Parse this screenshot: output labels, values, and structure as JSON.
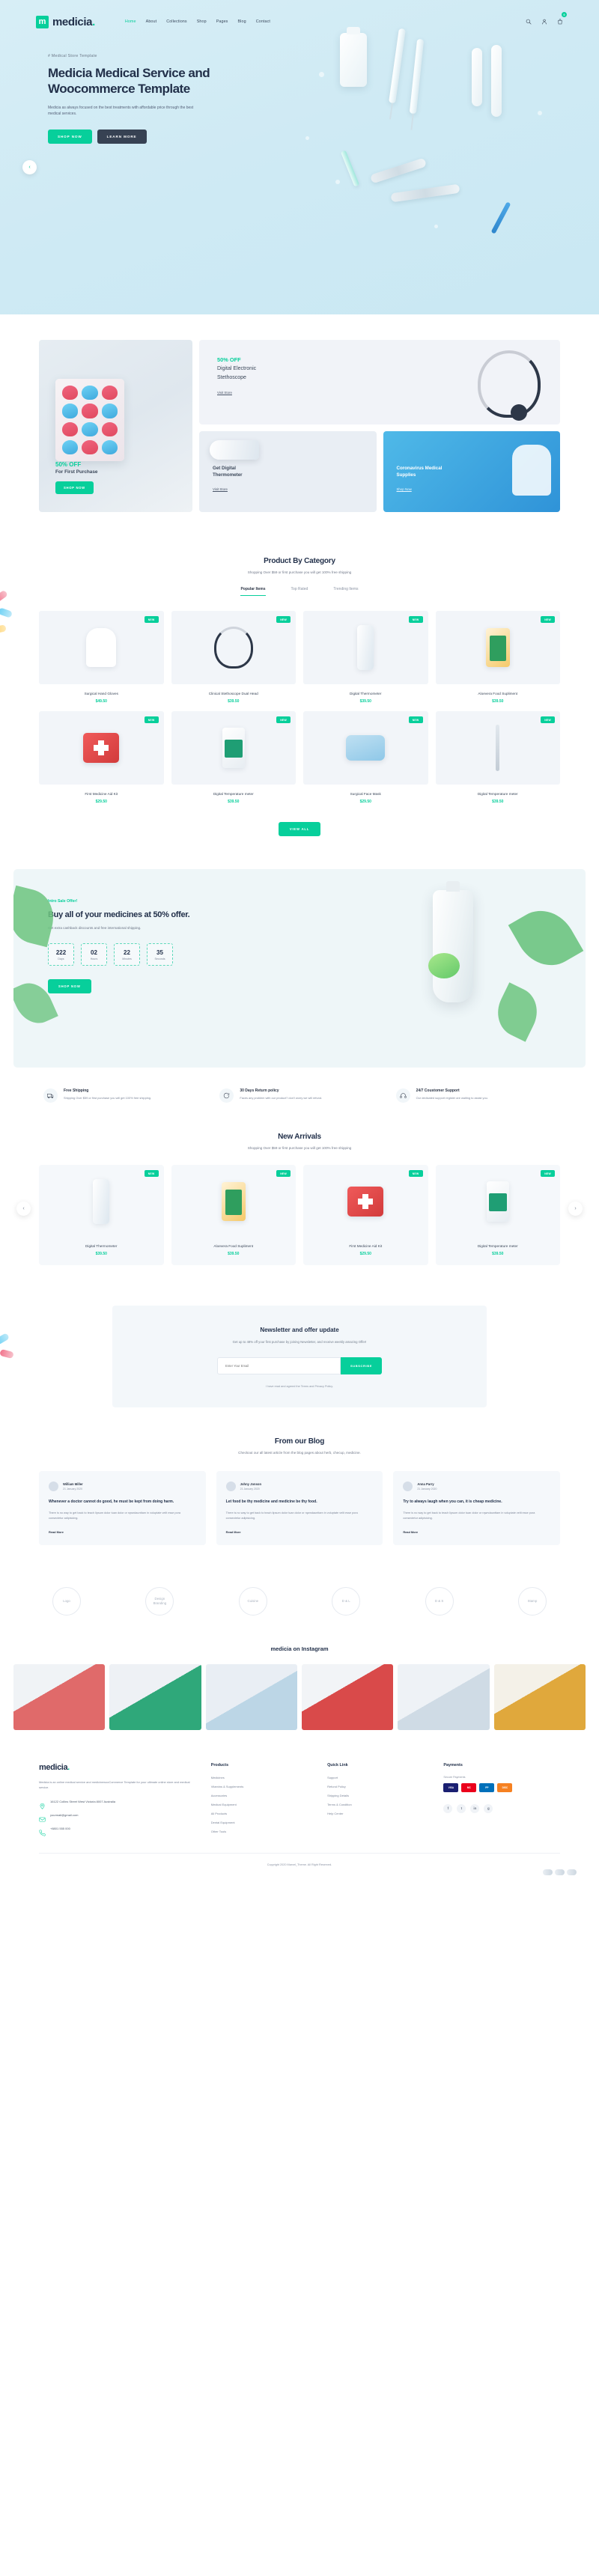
{
  "brand": {
    "name": "medicia",
    "mark": "m",
    "dot": "."
  },
  "colors": {
    "accent": "#07cf9b",
    "dark": "#22304a",
    "muted": "#7d8699"
  },
  "nav": {
    "links": [
      {
        "label": "Home",
        "active": true
      },
      {
        "label": "About",
        "active": false
      },
      {
        "label": "Collections",
        "active": false
      },
      {
        "label": "Shop",
        "active": false
      },
      {
        "label": "Pages",
        "active": false
      },
      {
        "label": "Blog",
        "active": false
      },
      {
        "label": "Contact",
        "active": false
      }
    ],
    "icons": [
      "search-icon",
      "user-icon",
      "cart-icon"
    ],
    "cart_count": "0"
  },
  "hero": {
    "kicker": "# Medical Store Template",
    "title_line1": "Medicia Medical Service and",
    "title_line2": "Woocommerce Template",
    "subtitle": "Medicia as always focused on the best treatments with affordable price through the best medical services.",
    "btn_primary": "SHOP NOW",
    "btn_secondary": "LEARN MORE",
    "arrow_left": "‹"
  },
  "promo": {
    "left": {
      "off": "50% OFF",
      "sub": "For First Purchase",
      "btn": "SHOP NOW"
    },
    "top": {
      "off": "50% OFF",
      "line1": "Digital Electronic",
      "line2": "Stethoscope",
      "link": "Visit Store"
    },
    "cards": [
      {
        "title": "Get Digital\nThermometer",
        "link": "Visit Store"
      },
      {
        "title": "Coronavirus Medical\nSupplies",
        "link": "Shop Now"
      }
    ]
  },
  "category": {
    "title": "Product By Category",
    "subtitle": "Shopping Over $59 or first purchase you will get 100% free shipping",
    "tabs": [
      {
        "label": "Popular Items",
        "active": true
      },
      {
        "label": "Top Rated",
        "active": false
      },
      {
        "label": "Trending Items",
        "active": false
      }
    ],
    "view_all": "VIEW ALL",
    "products": [
      {
        "name": "Surgical Hand Gloves",
        "price": "$49.50",
        "badge": "NEW",
        "art": "gloves"
      },
      {
        "name": "Clinical Stethoscope Dual Head",
        "price": "$39.50",
        "badge": "NEW",
        "art": "stetho"
      },
      {
        "name": "Digital Thermometer",
        "price": "$39.50",
        "badge": "NEW",
        "art": "therm"
      },
      {
        "name": "Aloevera Food Supliment",
        "price": "$39.50",
        "badge": "NEW",
        "art": "bottle"
      },
      {
        "name": "First Medicine Aid Kit",
        "price": "$29.50",
        "badge": "NEW",
        "art": "kit"
      },
      {
        "name": "Digital Temperature meter",
        "price": "$39.50",
        "badge": "NEW",
        "art": "suppl"
      },
      {
        "name": "Surgical Face Mask",
        "price": "$29.50",
        "badge": "NEW",
        "art": "mask"
      },
      {
        "name": "Digital Temperature meter",
        "price": "$39.50",
        "badge": "NEW",
        "art": "stick"
      }
    ]
  },
  "sale": {
    "kicker": "Intro Sale Offer!",
    "title": "Buy all of your medicines at 50% offer.",
    "subtitle": "Get extra cashback discounts and free international shipping.",
    "countdown": [
      {
        "value": "222",
        "label": "Days"
      },
      {
        "value": "02",
        "label": "Hours"
      },
      {
        "value": "22",
        "label": "Minutes"
      },
      {
        "value": "35",
        "label": "Seconds"
      }
    ],
    "btn": "SHOP NOW"
  },
  "features": [
    {
      "icon": "truck-icon",
      "title": "Free Shipping",
      "text": "Shipping Over $59 or first purchase you will get 100% free shipping."
    },
    {
      "icon": "refresh-icon",
      "title": "30 Days Return policy",
      "text": "Faces any problem with our product? don't worry we will refund."
    },
    {
      "icon": "headset-icon",
      "title": "24/7 Coustomer Support",
      "text": "Our dedicated support register are waiting to assist you."
    }
  ],
  "arrivals": {
    "title": "New Arrivals",
    "subtitle": "Shopping Over $59 or first purchase you will get 100% free shipping",
    "arrow_left": "‹",
    "arrow_right": "›",
    "products": [
      {
        "name": "Digital Thermometer",
        "price": "$39.50",
        "badge": "NEW",
        "art": "therm"
      },
      {
        "name": "Aloevera Food Supliment",
        "price": "$39.50",
        "badge": "NEW",
        "art": "bottle"
      },
      {
        "name": "First Medicine Aid Kit",
        "price": "$29.50",
        "badge": "NEW",
        "art": "kit"
      },
      {
        "name": "Digital Temperature meter",
        "price": "$39.50",
        "badge": "NEW",
        "art": "suppl"
      }
    ]
  },
  "newsletter": {
    "title": "Newsletter and offer update",
    "subtitle": "Get up to 48% off your first purchase by joining Newsletter, and receive weekly amazing Offer!",
    "placeholder": "Enter Your Email",
    "btn": "SUBSCRIBE",
    "note": "I have read and agreed the Terms and Privacy Policy."
  },
  "blog": {
    "title": "From our Blog",
    "subtitle": "Checkout our all latest article from the blog pages about herb, checup, medicine.",
    "read_more": "Read More",
    "posts": [
      {
        "author": "William Miller",
        "date": "21 January 2020",
        "title": "Whenever a doctor cannot do good, he must be kept from doing harm.",
        "text": "There is no way to get back to teach lipsum dolor tuan dolor or rqwndaunttam in voluptate velit esse pora consectetur adipisicing."
      },
      {
        "author": "Johny Jonson",
        "date": "21 January 2020",
        "title": "Let food be thy medicine and medicine be thy food.",
        "text": "There is no way to get back to teach lipsum dolor tuan dolor or rqwndaunttam in voluptate velit esse pora consectetur adipisicing."
      },
      {
        "author": "Anna Parry",
        "date": "21 January 2020",
        "title": "Try to always laugh when you can, it is cheap medicine.",
        "text": "There is no way to get back to teach lipsum dolor tuan dolor or rqwndaunttam in voluptate velit esse pora consectetur adipisicing."
      }
    ]
  },
  "brands": [
    {
      "label": "Logo"
    },
    {
      "label": "Design\nBranding"
    },
    {
      "label": "Cuisine"
    },
    {
      "label": "D & L"
    },
    {
      "label": "D & S"
    },
    {
      "label": "Stamp"
    }
  ],
  "instagram": {
    "title": "medicia on Instagram",
    "cells": 6
  },
  "footer": {
    "logo": "medicia",
    "about": "Medicia is an online medical service and medicinewooCommerce Template for your ultimate online store and medical service.",
    "address": "16122 Collins Street West Victoria 8007 Australia",
    "email": "yourmail@gmail.com",
    "phone": "+8801 555 000",
    "columns": [
      {
        "head": "Products",
        "links": [
          "Medicines",
          "Vitamins & Supplements",
          "Accessories",
          "Medical Equipment",
          "All Products",
          "Dental Equipment",
          "Other Tools"
        ]
      },
      {
        "head": "Quick Link",
        "links": [
          "Support",
          "Refund Policy",
          "Shipping Details",
          "Terms & Condition",
          "Help Center"
        ]
      }
    ],
    "payments": {
      "head": "Payments",
      "label": "Secure Payments",
      "methods": [
        "VISA",
        "MC",
        "PP",
        "DISC"
      ]
    },
    "socials": [
      "f",
      "t",
      "in",
      "g"
    ],
    "copyright": "Copyright 2020 Marvel_Theme. All Right Reserved."
  }
}
